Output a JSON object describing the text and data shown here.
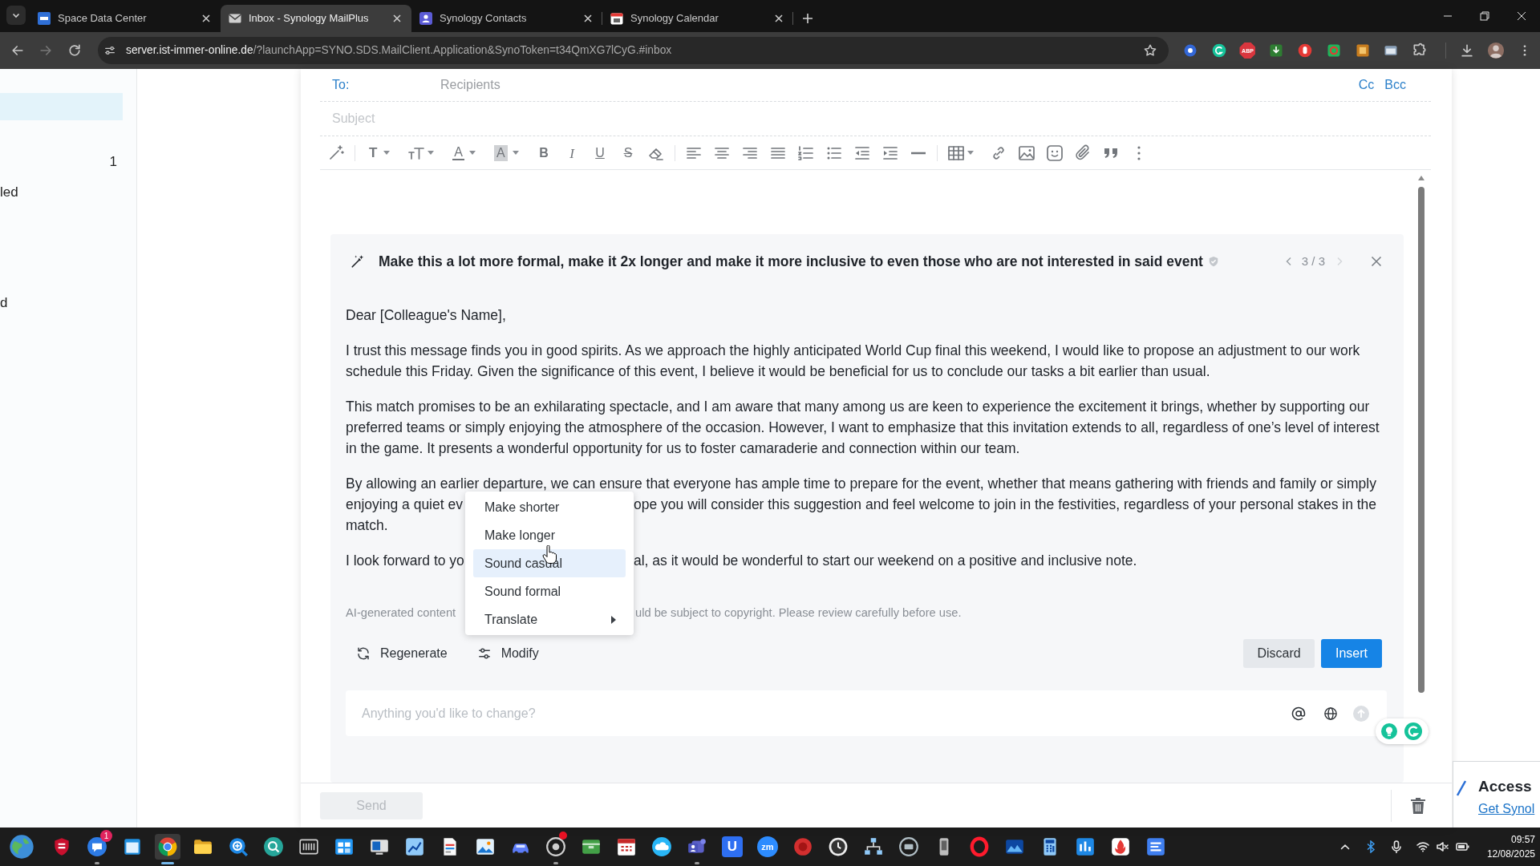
{
  "browser": {
    "tabs": [
      {
        "title": "Space Data Center",
        "kind": "site",
        "selected": false
      },
      {
        "title": "Inbox - Synology MailPlus",
        "kind": "mail",
        "selected": true
      },
      {
        "title": "Synology Contacts",
        "kind": "contacts",
        "selected": false
      },
      {
        "title": "Synology Calendar",
        "kind": "calendar",
        "selected": false
      }
    ],
    "address": {
      "host": "server.ist-immer-online.de",
      "path": "/?launchApp=SYNO.SDS.MailClient.Application&SynoToken=t34QmXG7lCyG.#inbox"
    },
    "extension_badge": "ABP"
  },
  "sidebar": {
    "items": [
      {
        "selected": true
      },
      {
        "count": "1",
        "selected": false
      },
      {
        "label": "led",
        "selected": false
      },
      {
        "label": "d",
        "selected": false
      }
    ]
  },
  "compose": {
    "to_label": "To:",
    "recipients_placeholder": "Recipients",
    "cc": "Cc",
    "bcc": "Bcc",
    "subject_placeholder": "Subject",
    "toolbar_labels": [
      "T",
      "A",
      "A",
      "B",
      "I",
      "U",
      "S"
    ],
    "send": "Send",
    "send_disabled": true
  },
  "ai_panel": {
    "prompt": "Make this a lot more formal, make it 2x longer and make it more inclusive to even those who are not interested in said event",
    "pager": "3 / 3",
    "prev_disabled": false,
    "next_disabled": true,
    "paragraphs": [
      {
        "kind": "whole",
        "text": "Dear [Colleague's Name],"
      },
      {
        "kind": "whole",
        "text": "I trust this message finds you in good spirits. As we approach the highly anticipated World Cup final this weekend, I would like to propose an adjustment to our work schedule this Friday. Given the significance of this event, I believe it would be beneficial for us to conclude our tasks a bit earlier than usual."
      },
      {
        "kind": "whole",
        "text": "This match promises to be an exhilarating spectacle, and I am aware that many among us are keen to experience the excitement it brings, whether by supporting our preferred teams or simply enjoying the atmosphere of the occasion. However, I want to emphasize that this invitation extends to all, regardless of one’s level of interest in the game. It presents a wonderful opportunity for us to foster camaraderie and connection within our team."
      },
      {
        "kind": "covered",
        "lines": [
          [
            "By allowing an earlier departure, we can ensure that everyone has ample time to prepare for the event, whether that means gathering with friends and family or simply"
          ],
          [
            "enjoying a quiet ev",
            "ope you will consider this suggestion and feel welcome to join in the festivities, regardless of your personal stakes in the"
          ],
          [
            "match."
          ]
        ]
      },
      {
        "kind": "covered",
        "lines": [
          [
            "I look forward to yo",
            "al, as it would be wonderful to start our weekend on a positive and inclusive note."
          ]
        ]
      }
    ],
    "disclaimer": [
      "AI-generated content",
      "uld be subject to copyright. Please review carefully before use."
    ],
    "actions": [
      {
        "kind": "regenerate",
        "label": "Regenerate"
      },
      {
        "kind": "modify",
        "label": "Modify"
      }
    ],
    "discard": "Discard",
    "insert": "Insert",
    "input_placeholder": "Anything you'd like to change?",
    "menu": [
      {
        "label": "Make shorter",
        "selected": false,
        "submenu": false
      },
      {
        "label": "Make longer",
        "selected": false,
        "submenu": false
      },
      {
        "label": "Sound casual",
        "selected": true,
        "submenu": false
      },
      {
        "label": "Sound formal",
        "selected": false,
        "submenu": false
      },
      {
        "label": "Translate",
        "selected": false,
        "submenu": true
      }
    ]
  },
  "notification": {
    "title": "Access",
    "link": "Get Synol"
  },
  "taskbar": {
    "apps": [
      {
        "kind": "globe",
        "running": false,
        "selected": false,
        "alert": false
      },
      {
        "kind": "shield",
        "running": false,
        "selected": false,
        "alert": false
      },
      {
        "kind": "chat",
        "running": true,
        "selected": false,
        "alert": false,
        "badge": "1"
      },
      {
        "kind": "window",
        "running": false,
        "selected": false,
        "alert": false
      },
      {
        "kind": "browser",
        "running": true,
        "selected": true,
        "alert": false
      },
      {
        "kind": "folder",
        "running": false,
        "selected": false,
        "alert": false
      },
      {
        "kind": "magnifier",
        "running": false,
        "selected": false,
        "alert": false
      },
      {
        "kind": "search",
        "running": false,
        "selected": false,
        "alert": false
      },
      {
        "kind": "striped",
        "running": false,
        "selected": false,
        "alert": false
      },
      {
        "kind": "tiles",
        "running": false,
        "selected": false,
        "alert": false
      },
      {
        "kind": "monitor",
        "running": false,
        "selected": false,
        "alert": false
      },
      {
        "kind": "chart",
        "running": false,
        "selected": false,
        "alert": false
      },
      {
        "kind": "document",
        "running": false,
        "selected": false,
        "alert": false
      },
      {
        "kind": "picture",
        "running": false,
        "selected": false,
        "alert": false
      },
      {
        "kind": "car",
        "running": false,
        "selected": false,
        "alert": false
      },
      {
        "kind": "disc",
        "running": true,
        "selected": false,
        "alert": true
      },
      {
        "kind": "box",
        "running": false,
        "selected": false,
        "alert": false
      },
      {
        "kind": "calendar",
        "running": false,
        "selected": false,
        "alert": false
      },
      {
        "kind": "cloud",
        "running": false,
        "selected": false,
        "alert": false
      },
      {
        "kind": "people",
        "running": true,
        "selected": false,
        "alert": false
      },
      {
        "kind": "letter",
        "label": "U",
        "running": false,
        "selected": false,
        "alert": false
      },
      {
        "kind": "round",
        "label": "zm",
        "running": false,
        "selected": false,
        "alert": false
      },
      {
        "kind": "record",
        "running": false,
        "selected": false,
        "alert": false
      },
      {
        "kind": "clock",
        "running": false,
        "selected": false,
        "alert": false
      },
      {
        "kind": "network",
        "running": false,
        "selected": false,
        "alert": false
      },
      {
        "kind": "screen",
        "running": false,
        "selected": false,
        "alert": false
      },
      {
        "kind": "phone",
        "running": false,
        "selected": false,
        "alert": false
      },
      {
        "kind": "ring",
        "running": false,
        "selected": false,
        "alert": false
      },
      {
        "kind": "landscape",
        "running": false,
        "selected": false,
        "alert": false
      },
      {
        "kind": "calculator",
        "running": false,
        "selected": false,
        "alert": false
      },
      {
        "kind": "bars",
        "running": false,
        "selected": false,
        "alert": false
      },
      {
        "kind": "flame",
        "running": false,
        "selected": false,
        "alert": false
      },
      {
        "kind": "lines",
        "running": false,
        "selected": false,
        "alert": false
      }
    ],
    "time": "09:57",
    "date": "12/08/2025"
  }
}
